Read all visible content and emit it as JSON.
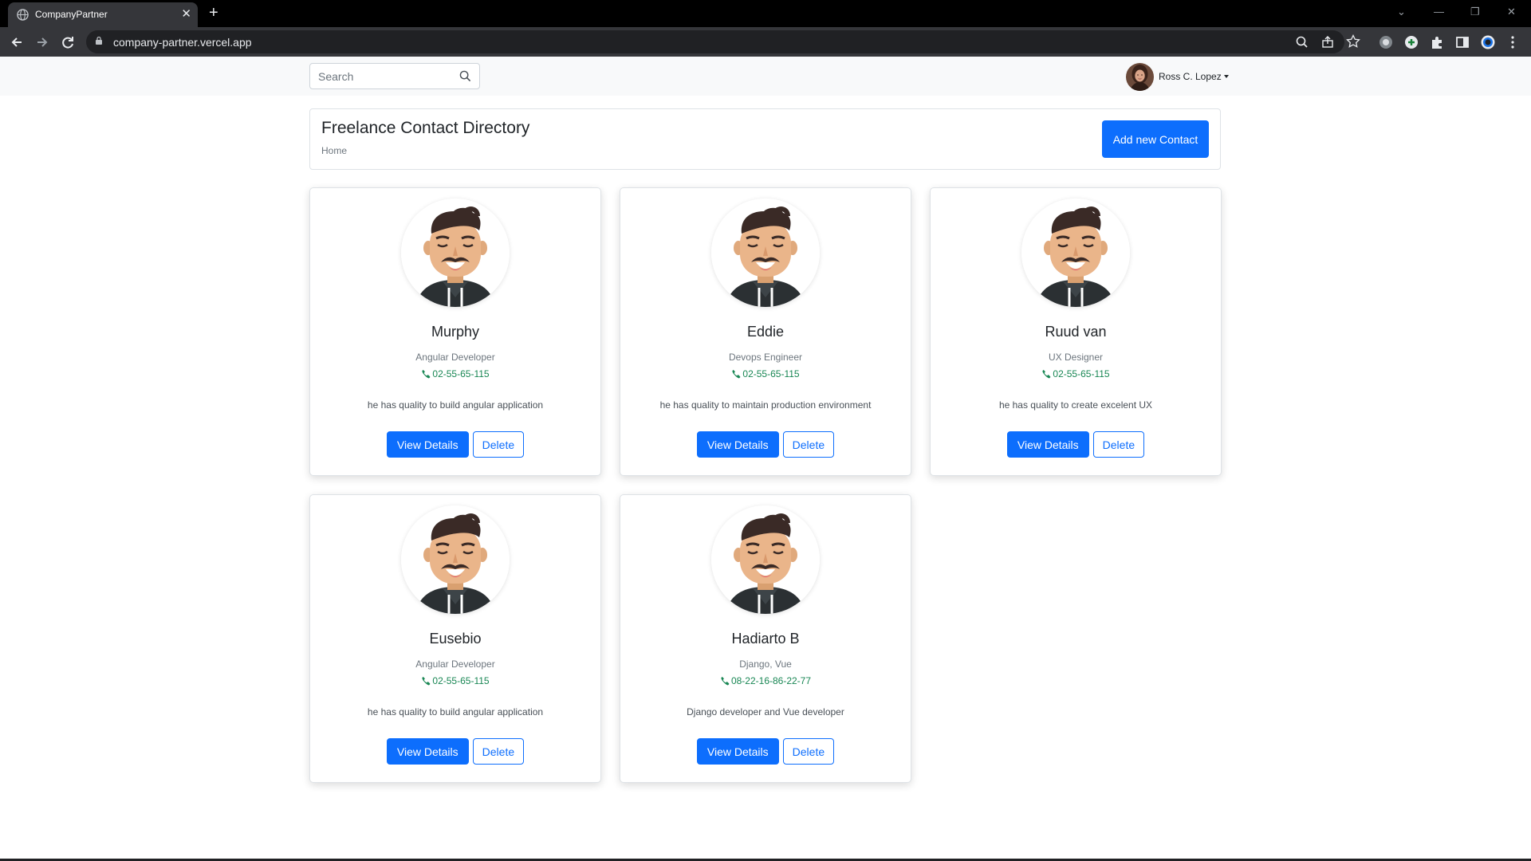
{
  "browser": {
    "tab_title": "CompanyPartner",
    "tab_close": "✕",
    "new_tab": "+",
    "url": "company-partner.vercel.app",
    "window_controls": [
      "⌄",
      "—",
      "❐",
      "✕"
    ]
  },
  "navbar": {
    "search_placeholder": "Search",
    "user_name": "Ross C. Lopez"
  },
  "header": {
    "title": "Freelance Contact Directory",
    "breadcrumb": "Home",
    "add_button": "Add new Contact"
  },
  "contacts": [
    {
      "name": "Murphy",
      "role": "Angular Developer",
      "phone": "02-55-65-115",
      "description": "he has quality to build angular application"
    },
    {
      "name": "Eddie",
      "role": "Devops Engineer",
      "phone": "02-55-65-115",
      "description": "he has quality to maintain production environment"
    },
    {
      "name": "Ruud van",
      "role": "UX Designer",
      "phone": "02-55-65-115",
      "description": "he has quality to create excelent UX"
    },
    {
      "name": "Eusebio",
      "role": "Angular Developer",
      "phone": "02-55-65-115",
      "description": "he has quality to build angular application"
    },
    {
      "name": "Hadiarto B",
      "role": "Django, Vue",
      "phone": "08-22-16-86-22-77",
      "description": "Django developer and Vue developer"
    }
  ],
  "card_actions": {
    "view_label": "View Details",
    "delete_label": "Delete"
  },
  "icons": {
    "favicon": "globe-icon",
    "search": "search-icon",
    "phone": "phone-icon",
    "lock": "lock-icon"
  },
  "colors": {
    "primary": "#0d6efd",
    "phone_green": "#198754",
    "navbar_bg": "#f8f9fa",
    "chrome_dark": "#35363a"
  }
}
